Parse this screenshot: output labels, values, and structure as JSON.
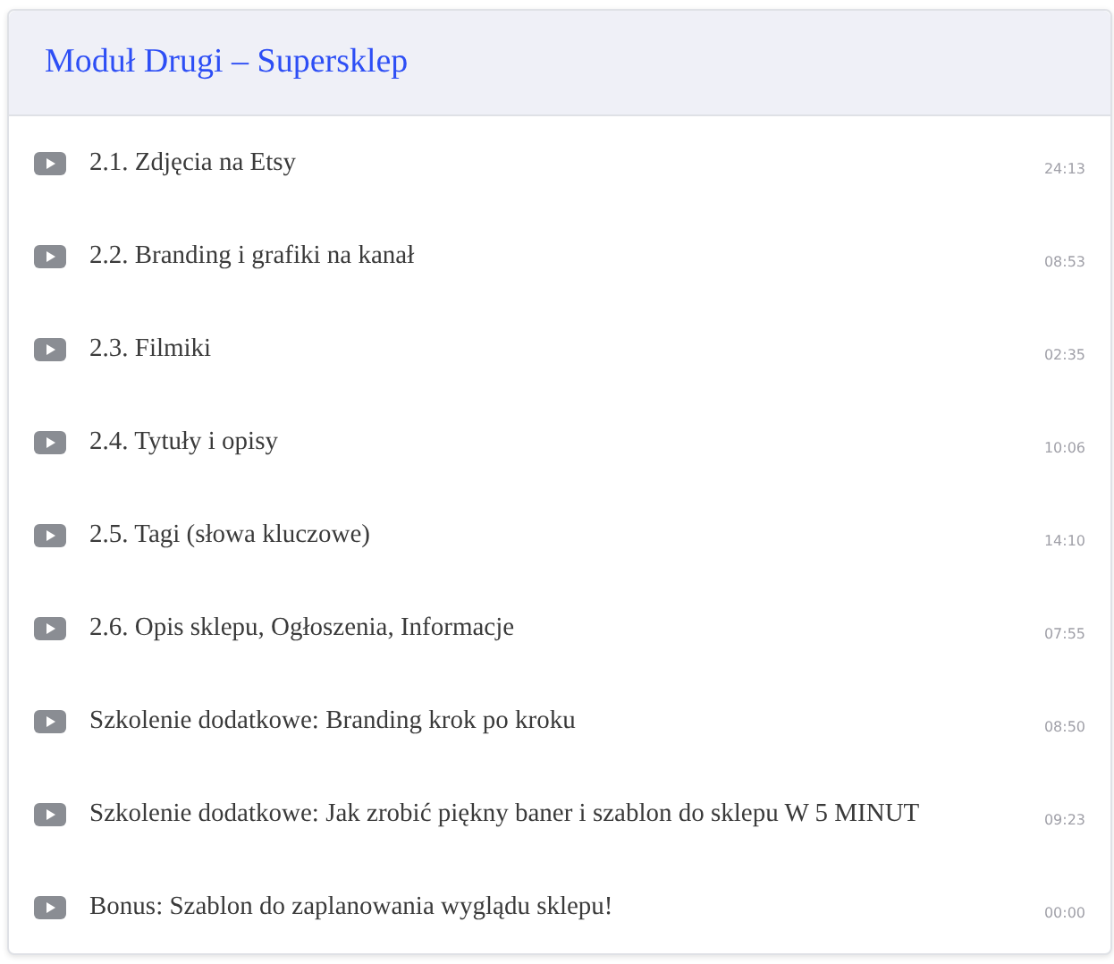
{
  "module": {
    "title": "Moduł Drugi – Supersklep"
  },
  "lessons": [
    {
      "title": "2.1. Zdjęcia na Etsy",
      "duration": "24:13"
    },
    {
      "title": "2.2. Branding i grafiki na kanał",
      "duration": "08:53"
    },
    {
      "title": "2.3. Filmiki",
      "duration": "02:35"
    },
    {
      "title": "2.4. Tytuły i opisy",
      "duration": "10:06"
    },
    {
      "title": "2.5. Tagi (słowa kluczowe)",
      "duration": "14:10"
    },
    {
      "title": "2.6. Opis sklepu, Ogłoszenia, Informacje",
      "duration": "07:55"
    },
    {
      "title": "Szkolenie dodatkowe: Branding krok po kroku",
      "duration": "08:50"
    },
    {
      "title": "Szkolenie dodatkowe: Jak zrobić piękny baner i szablon do sklepu W 5 MINUT",
      "duration": "09:23"
    },
    {
      "title": "Bonus: Szablon do zaplanowania wyglądu sklepu!",
      "duration": "00:00"
    }
  ]
}
